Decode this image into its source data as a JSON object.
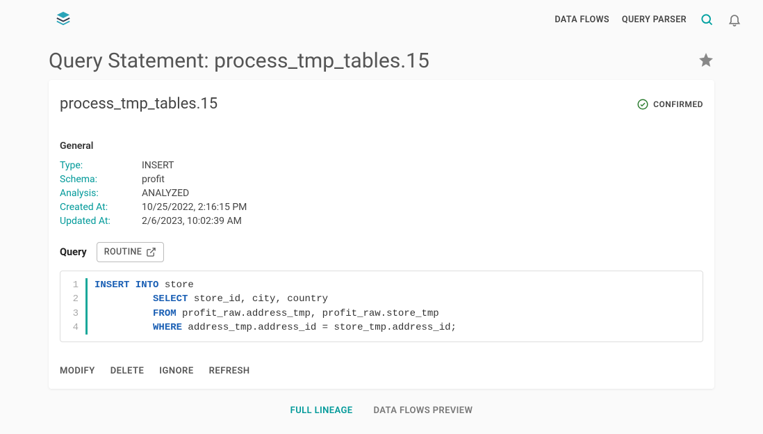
{
  "nav": {
    "links": [
      "DATA FLOWS",
      "QUERY PARSER"
    ]
  },
  "page": {
    "title": "Query Statement: process_tmp_tables.15"
  },
  "card": {
    "title": "process_tmp_tables.15",
    "status": "CONFIRMED",
    "general_label": "General",
    "meta": {
      "type_key": "Type:",
      "type_val": "INSERT",
      "schema_key": "Schema:",
      "schema_val": "profit",
      "analysis_key": "Analysis:",
      "analysis_val": "ANALYZED",
      "created_key": "Created At:",
      "created_val": "10/25/2022, 2:16:15 PM",
      "updated_key": "Updated At:",
      "updated_val": "2/6/2023, 10:02:39 AM"
    },
    "query_label": "Query",
    "routine_btn": "ROUTINE",
    "sql": {
      "line1": {
        "k1": "INSERT INTO",
        "r1": " store"
      },
      "line2": {
        "pad": "          ",
        "k1": "SELECT",
        "r1": " store_id, city, country"
      },
      "line3": {
        "pad": "          ",
        "k1": "FROM",
        "r1": " profit_raw.address_tmp, profit_raw.store_tmp"
      },
      "line4": {
        "pad": "          ",
        "k1": "WHERE",
        "r1": " address_tmp.address_id = store_tmp.address_id;"
      }
    },
    "actions": {
      "modify": "MODIFY",
      "delete": "DELETE",
      "ignore": "IGNORE",
      "refresh": "REFRESH"
    }
  },
  "tabs": {
    "full_lineage": "FULL LINEAGE",
    "data_flows_preview": "DATA FLOWS PREVIEW"
  }
}
